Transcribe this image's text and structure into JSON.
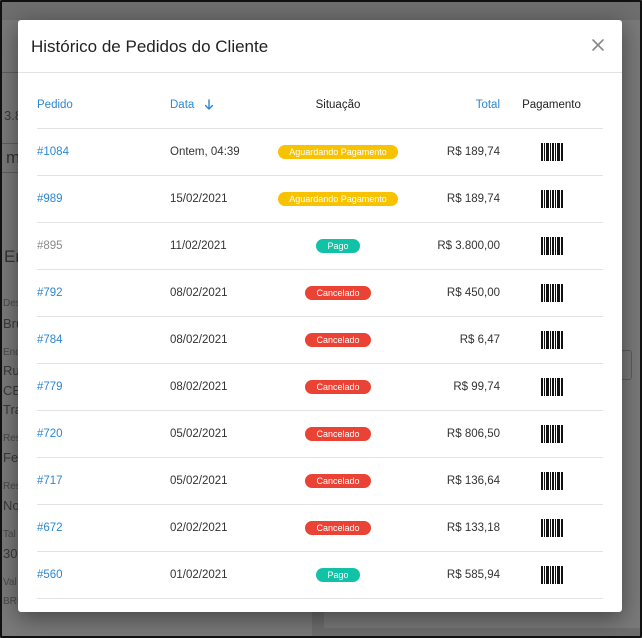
{
  "modal": {
    "title": "Histórico de Pedidos do Cliente"
  },
  "table": {
    "headers": {
      "pedido": "Pedido",
      "data": "Data",
      "situacao": "Situação",
      "total": "Total",
      "pagamento": "Pagamento"
    },
    "rows": [
      {
        "pedido": "#1084",
        "data": "Ontem, 04:39",
        "situacao": "Aguardando Pagamento",
        "status": "aguardando",
        "total": "R$ 189,74",
        "muted": false
      },
      {
        "pedido": "#989",
        "data": "15/02/2021",
        "situacao": "Aguardando Pagamento",
        "status": "aguardando",
        "total": "R$ 189,74",
        "muted": false
      },
      {
        "pedido": "#895",
        "data": "11/02/2021",
        "situacao": "Pago",
        "status": "pago",
        "total": "R$ 3.800,00",
        "muted": true
      },
      {
        "pedido": "#792",
        "data": "08/02/2021",
        "situacao": "Cancelado",
        "status": "cancelado",
        "total": "R$ 450,00",
        "muted": false
      },
      {
        "pedido": "#784",
        "data": "08/02/2021",
        "situacao": "Cancelado",
        "status": "cancelado",
        "total": "R$ 6,47",
        "muted": false
      },
      {
        "pedido": "#779",
        "data": "08/02/2021",
        "situacao": "Cancelado",
        "status": "cancelado",
        "total": "R$ 99,74",
        "muted": false
      },
      {
        "pedido": "#720",
        "data": "05/02/2021",
        "situacao": "Cancelado",
        "status": "cancelado",
        "total": "R$ 806,50",
        "muted": false
      },
      {
        "pedido": "#717",
        "data": "05/02/2021",
        "situacao": "Cancelado",
        "status": "cancelado",
        "total": "R$ 136,64",
        "muted": false
      },
      {
        "pedido": "#672",
        "data": "02/02/2021",
        "situacao": "Cancelado",
        "status": "cancelado",
        "total": "R$ 133,18",
        "muted": false
      },
      {
        "pedido": "#560",
        "data": "01/02/2021",
        "situacao": "Pago",
        "status": "pago",
        "total": "R$ 585,94",
        "muted": false
      }
    ]
  },
  "background": {
    "fragments": [
      "3.8",
      "m",
      "En",
      "Des",
      "Bru",
      "End",
      "Ru",
      "CE",
      "Tra",
      "Res",
      "Fe",
      "Res",
      "No",
      "Tal",
      "30",
      "Val",
      "BRL"
    ]
  },
  "icons": {
    "close": "close-icon",
    "sort": "arrow-down-icon",
    "payment": "barcode-icon"
  },
  "colors": {
    "link": "#2d87d3",
    "aguardando": "#f7c200",
    "pago": "#12c2a6",
    "cancelado": "#ea4335"
  }
}
